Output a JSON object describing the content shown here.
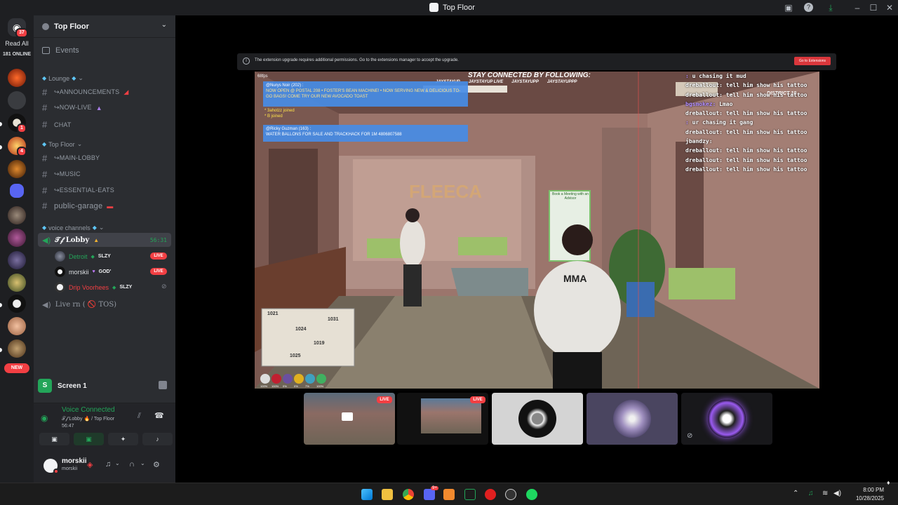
{
  "window": {
    "title": "Top Floor"
  },
  "rail": {
    "home_badge": "37",
    "read_all": "Read All",
    "online": "181 ONLINE",
    "server_badges": [
      "1",
      "4"
    ],
    "new_badge": "NEW"
  },
  "sidebar": {
    "guild_name": "Top Floor",
    "events_label": "Events",
    "categories": {
      "lounge": "Lounge",
      "top_floor": "Top Floor",
      "voice": "voice channels"
    },
    "channels": {
      "announcements": "↪ANNOUNCEMENTS",
      "now_live": "↪NOW-LIVE",
      "chat": "CHAT",
      "main_lobby": "↪MAIN-LOBBY",
      "music": "↪MUSIC",
      "essential_eats": "↪ESSENTIAL-EATS",
      "public_garage": "public-garage"
    },
    "voice_lobby": {
      "name": "𝒯𝒻 Lobby",
      "time": "56:31"
    },
    "voice_users": [
      {
        "name": "Detroit",
        "tag": "SLZY",
        "live": "LIVE",
        "color": "#23a559"
      },
      {
        "name": "morskii",
        "tag": "GOD'",
        "live": "LIVE",
        "color": "#dbdee1"
      },
      {
        "name": "Drip Voorhees",
        "tag": "SLZY",
        "live": "",
        "color": "#f23f43"
      }
    ],
    "voice_other": "Live rn ( 🚫 TOS)"
  },
  "screen_share": {
    "label": "Screen 1"
  },
  "voice_panel": {
    "status": "Voice Connected",
    "location": "𝒯𝒻 Lobby 🔥 / Top Floor",
    "elapsed": "56:47"
  },
  "user_panel": {
    "name": "morskii",
    "handle": "morskii"
  },
  "extension_bar": {
    "message": "The extension upgrade requires additional permissions. Go to the extensions manager to accept the upgrade.",
    "button": "Go to Extensions"
  },
  "stream": {
    "fps": "68fps",
    "banner": "STAY CONNECTED BY FOLLOWING:",
    "socials": [
      "JAYSTAYUP",
      "JAYSTAYUP LIVE",
      "JAYSTAYUPP",
      "JAYSTAYUPPP"
    ],
    "msg1_author": "@Nurys Noir (202) :",
    "msg1_text": "NOW OPEN @ POSTAL 208 • FOSTER'S BEAN MACHINE! • NOW SERVING NEW & DELICIOUS TO-GO BAGS! COME TRY OUR NEW AVOCADO TOAST",
    "join1": "* 3ahotzz joined",
    "join2": "* B joined",
    "msg2_author": "@Ricky Guzman (163) :",
    "msg2_text": "WATER BALLONS FOR SALE AND TRACKHACK FOR 1M 4806807588",
    "sign": "FLEECA",
    "poster": "Book a Meeting with an Advisor",
    "hoodie": "MMA",
    "district": "DISTRICT 10",
    "chat": [
      {
        "user": "",
        "text": "u chasing it mud",
        "color": "#b08cff"
      },
      {
        "user": "dreballout",
        "text": "tell him show his tattoo",
        "color": "#ffffff"
      },
      {
        "user": "dreballout",
        "text": "tell him show his tattoo",
        "color": "#ffffff"
      },
      {
        "user": "bgsmokez",
        "text": "Lmao",
        "color": "#b08cff"
      },
      {
        "user": "dreballout",
        "text": "tell him show his tattoo",
        "color": "#ffffff"
      },
      {
        "user": "",
        "text": "ur chasing it gang",
        "color": "#b08cff"
      },
      {
        "user": "dreballout",
        "text": "tell him show his tattoo",
        "color": "#ffffff"
      },
      {
        "user": "jbandzy",
        "text": "",
        "color": "#ffffff"
      },
      {
        "user": "dreballout",
        "text": "tell him show his tattoo",
        "color": "#ffffff"
      },
      {
        "user": "dreballout",
        "text": "tell him show his tattoo",
        "color": "#ffffff"
      },
      {
        "user": "dreballout",
        "text": "tell him show his tattoo",
        "color": "#ffffff"
      }
    ],
    "minimap_numbers": [
      "1021",
      "1031",
      "1024",
      "1025",
      "1019"
    ],
    "hud_values": [
      "100%",
      "100%",
      "0%",
      "0%",
      "7%",
      "100%"
    ]
  },
  "thumbs": {
    "live": "LIVE"
  },
  "taskbar": {
    "time": "8:00 PM",
    "date": "10/28/2025",
    "discord_badge": "9+"
  }
}
